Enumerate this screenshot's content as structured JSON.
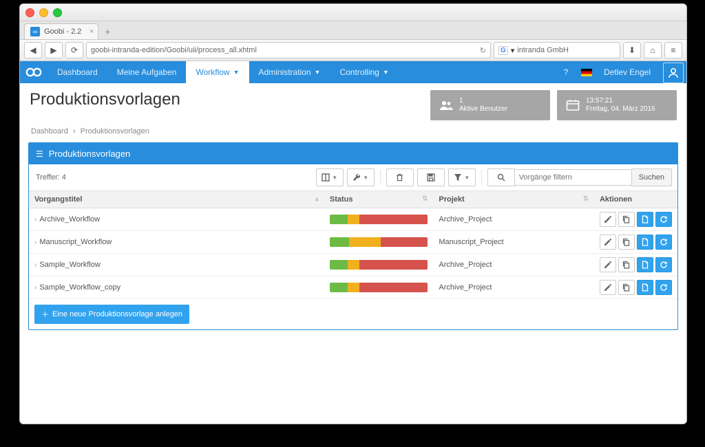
{
  "browser": {
    "tab_title": "Goobi - 2.2",
    "url": "goobi-intranda-edition/Goobi/uii/process_all.xhtml",
    "search_engine": "intranda GmbH"
  },
  "nav": {
    "items": [
      {
        "label": "Dashboard",
        "active": false,
        "dropdown": false
      },
      {
        "label": "Meine Aufgaben",
        "active": false,
        "dropdown": false
      },
      {
        "label": "Workflow",
        "active": true,
        "dropdown": true
      },
      {
        "label": "Administration",
        "active": false,
        "dropdown": true
      },
      {
        "label": "Controlling",
        "active": false,
        "dropdown": true
      }
    ],
    "help": "?",
    "user": "Detlev Engel"
  },
  "header": {
    "title": "Produktionsvorlagen",
    "users_count": "1",
    "users_label": "Aktive Benutzer",
    "time": "13:57:21",
    "date": "Freitag, 04. März 2016"
  },
  "breadcrumb": {
    "root": "Dashboard",
    "sep": "›",
    "current": "Produktionsvorlagen"
  },
  "panel": {
    "title": "Produktionsvorlagen",
    "hits": "Treffer: 4",
    "filter_placeholder": "Vorgänge filtern",
    "search_label": "Suchen",
    "columns": {
      "title": "Vorgangstitel",
      "status": "Status",
      "project": "Projekt",
      "actions": "Aktionen"
    },
    "rows": [
      {
        "title": "Archive_Workflow",
        "project": "Archive_Project",
        "status": [
          18,
          12,
          70
        ]
      },
      {
        "title": "Manuscript_Workflow",
        "project": "Manuscript_Project",
        "status": [
          20,
          32,
          48
        ]
      },
      {
        "title": "Sample_Workflow",
        "project": "Archive_Project",
        "status": [
          18,
          12,
          70
        ]
      },
      {
        "title": "Sample_Workflow_copy",
        "project": "Archive_Project",
        "status": [
          18,
          12,
          70
        ]
      }
    ],
    "new_button": "Eine neue Produktionsvorlage anlegen"
  }
}
